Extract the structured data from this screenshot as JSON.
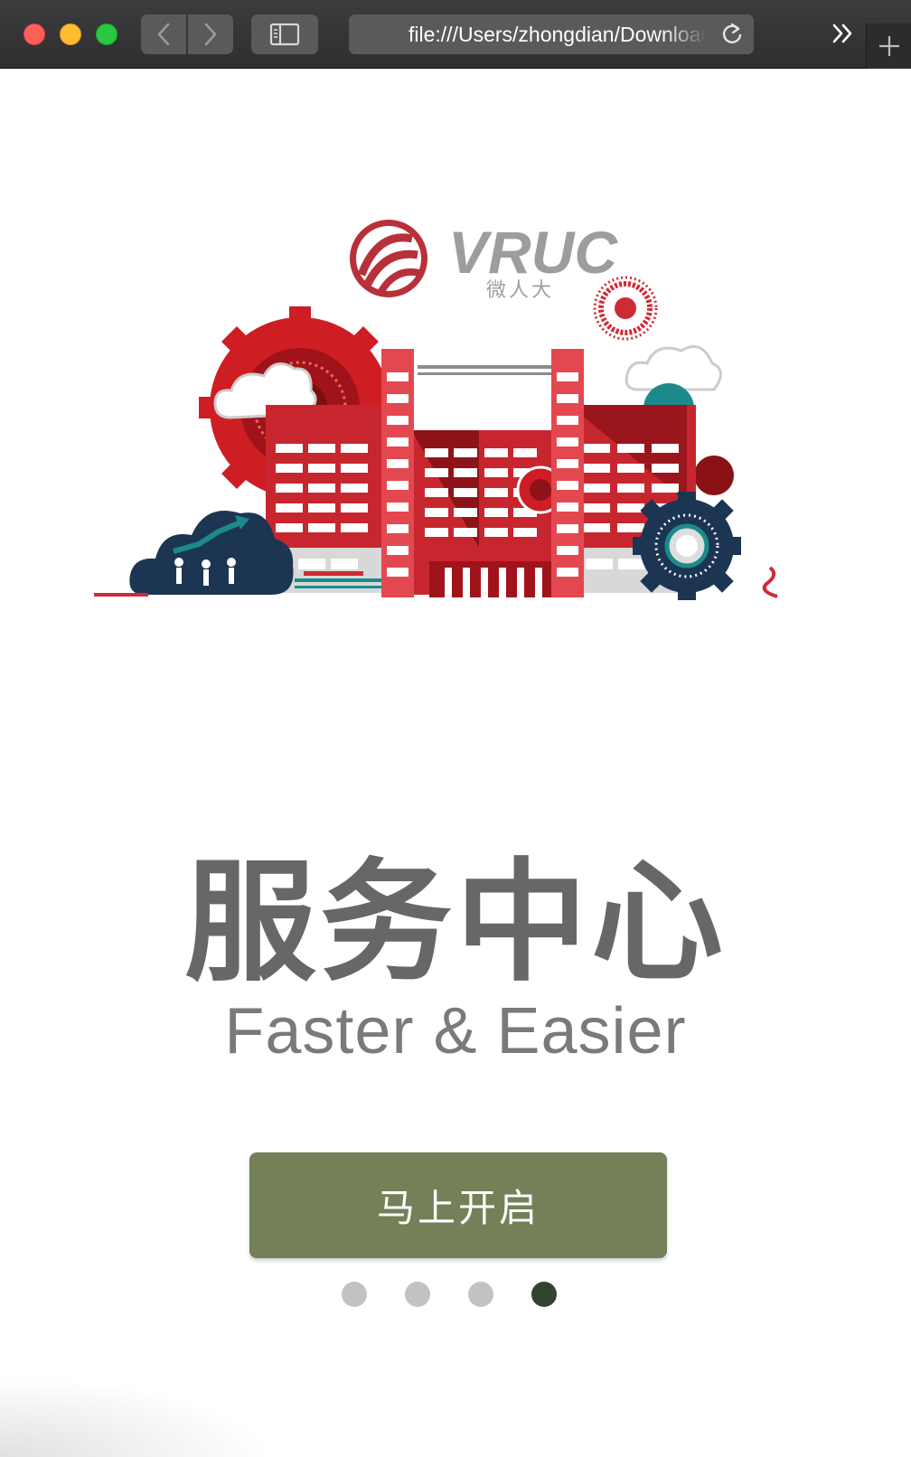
{
  "browser": {
    "address_url": "file:///Users/zhongdian/Downloads/index.html",
    "back_icon": "chevron-left-icon",
    "forward_icon": "chevron-right-icon",
    "sidebar_icon": "sidebar-icon",
    "reload_icon": "reload-icon",
    "overflow_icon": "double-chevron-right-icon",
    "newtab_icon": "plus-icon"
  },
  "logo": {
    "wordmark": "VRUC",
    "subtitle": "微人大"
  },
  "main": {
    "headline": "服务中心",
    "tagline": "Faster & Easier",
    "start_button": "马上开启"
  },
  "pagination": {
    "total": 4,
    "active_index": 3
  },
  "colors": {
    "accent_button": "#738058",
    "active_dot": "#32442f",
    "inactive_dot": "#c2c2c2",
    "brand_red": "#cf2b35",
    "navy": "#1c3553"
  }
}
